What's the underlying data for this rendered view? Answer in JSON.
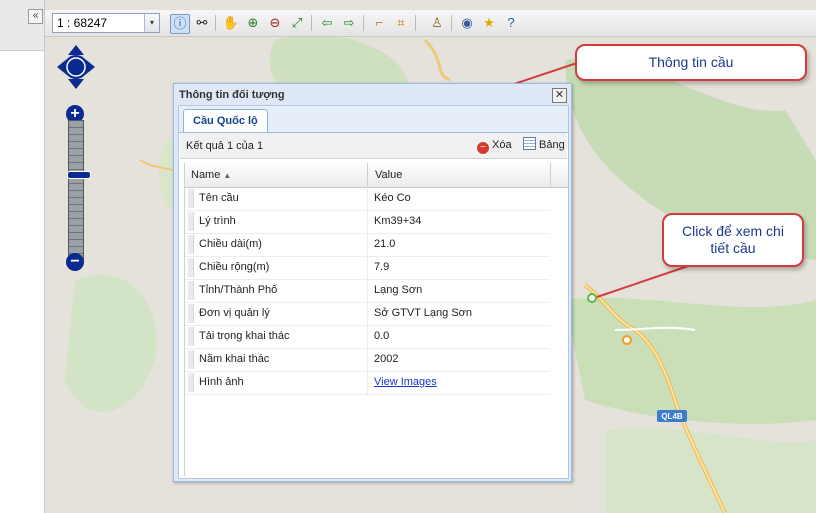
{
  "left_panel": {
    "collapse_label": "«"
  },
  "toolbar": {
    "scale_value": "1 : 68247",
    "dropdown_glyph": "▾",
    "icons": [
      "info-icon",
      "binoculars-icon",
      "hand-pan-icon",
      "zoom-in-icon",
      "zoom-out-icon",
      "full-extent-icon",
      "back-arrow-icon",
      "forward-arrow-icon",
      "measure-line-icon",
      "measure-area-icon",
      "stamp-icon",
      "eye-icon",
      "star-icon",
      "help-icon"
    ]
  },
  "zoom": {
    "plus": "+",
    "minus": "−"
  },
  "callouts": {
    "info": "Thông tin cầu",
    "click_line1": "Click để xem chi",
    "click_line2": "tiết cầu"
  },
  "map": {
    "road_label": "QL4B"
  },
  "dialog": {
    "title": "Thông tin đối tượng",
    "close_glyph": "✕",
    "tab": "Cầu Quốc lộ",
    "result_text": "Kết quả 1 của 1",
    "delete_label": "Xóa",
    "table_label": "Bảng",
    "col_name": "Name",
    "col_value": "Value",
    "rows": [
      {
        "name": "Tên cầu",
        "value": "Kéo Co"
      },
      {
        "name": "Lý trình",
        "value": "Km39+34"
      },
      {
        "name": "Chiều dài(m)",
        "value": "21.0"
      },
      {
        "name": "Chiều rộng(m)",
        "value": "7.9"
      },
      {
        "name": "Tỉnh/Thành Phố",
        "value": "Lạng Sơn"
      },
      {
        "name": "Đơn vị quản lý",
        "value": "Sở GTVT Lạng Sơn"
      },
      {
        "name": "Tải trọng khai thác",
        "value": "0.0"
      },
      {
        "name": "Năm khai thác",
        "value": "2002"
      },
      {
        "name": "Hình ảnh",
        "value": "View Images"
      }
    ]
  },
  "colors": {
    "accent": "#15428b",
    "callout_border": "#d23c3c",
    "callout_text": "#1b3a8a",
    "nav_blue": "#0a2a8f"
  }
}
